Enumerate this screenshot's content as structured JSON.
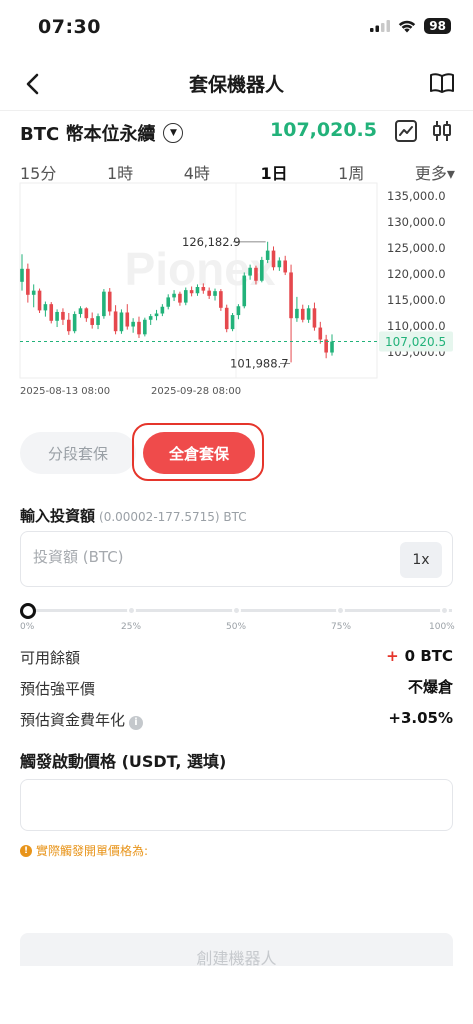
{
  "status_bar": {
    "time": "07:30",
    "battery": "98"
  },
  "nav": {
    "title": "套保機器人"
  },
  "pair": {
    "name": "BTC 幣本位永續",
    "price": "107,020.5"
  },
  "timeframes": [
    "15分",
    "1時",
    "4時",
    "1日",
    "1周",
    "更多▾"
  ],
  "active_timeframe": "1日",
  "chart_data": {
    "type": "candlestick",
    "y_ticks": [
      "135,000.0",
      "130,000.0",
      "125,000.0",
      "120,000.0",
      "115,000.0",
      "110,000.0",
      "105,000.0"
    ],
    "ylim": [
      105000,
      135000
    ],
    "x_ticks": [
      "2025-08-13 08:00",
      "2025-09-28 08:00"
    ],
    "annotations": {
      "high": "126,182.9",
      "low": "101,988.7"
    },
    "current_price": "107,020.5",
    "watermark": "Pionex",
    "candles": [
      [
        118500,
        123800,
        116800,
        121000
      ],
      [
        121000,
        122000,
        114500,
        116000
      ],
      [
        116000,
        118000,
        113600,
        116800
      ],
      [
        116800,
        117200,
        112500,
        113000
      ],
      [
        113000,
        114700,
        111800,
        114200
      ],
      [
        114200,
        114600,
        110500,
        111000
      ],
      [
        111000,
        113200,
        109800,
        112700
      ],
      [
        112700,
        113400,
        110200,
        111200
      ],
      [
        111200,
        112500,
        108300,
        109000
      ],
      [
        109000,
        112800,
        108600,
        112300
      ],
      [
        112300,
        113800,
        111600,
        113400
      ],
      [
        113400,
        113600,
        110800,
        111500
      ],
      [
        111500,
        112600,
        109500,
        110200
      ],
      [
        110200,
        112400,
        109400,
        111900
      ],
      [
        111900,
        117100,
        111400,
        116600
      ],
      [
        116600,
        117300,
        112000,
        112800
      ],
      [
        112800,
        114000,
        108400,
        109000
      ],
      [
        109000,
        113200,
        108500,
        112600
      ],
      [
        112600,
        114200,
        109300,
        109900
      ],
      [
        109900,
        111500,
        108700,
        110800
      ],
      [
        110800,
        111800,
        107700,
        108400
      ],
      [
        108400,
        111600,
        108000,
        111200
      ],
      [
        111200,
        112300,
        110200,
        111900
      ],
      [
        111900,
        113100,
        111100,
        112400
      ],
      [
        112400,
        114200,
        111900,
        113700
      ],
      [
        113700,
        116100,
        113200,
        115500
      ],
      [
        115500,
        116900,
        114800,
        116200
      ],
      [
        116200,
        116600,
        113900,
        114500
      ],
      [
        114500,
        117400,
        114000,
        116900
      ],
      [
        116900,
        117600,
        115700,
        116300
      ],
      [
        116300,
        118000,
        115800,
        117500
      ],
      [
        117500,
        118200,
        116200,
        116800
      ],
      [
        116800,
        117400,
        115200,
        115800
      ],
      [
        115800,
        117200,
        114900,
        116700
      ],
      [
        116700,
        117100,
        112900,
        113500
      ],
      [
        113500,
        114100,
        108800,
        109400
      ],
      [
        109400,
        112500,
        109000,
        112100
      ],
      [
        112100,
        114200,
        111300,
        113800
      ],
      [
        113800,
        120300,
        113400,
        119700
      ],
      [
        119700,
        121800,
        118900,
        121200
      ],
      [
        121200,
        121600,
        118000,
        118700
      ],
      [
        118700,
        123300,
        118400,
        122700
      ],
      [
        122700,
        126200,
        122100,
        124500
      ],
      [
        124500,
        125300,
        120700,
        121300
      ],
      [
        121300,
        123200,
        120600,
        122600
      ],
      [
        122600,
        123500,
        119800,
        120300
      ],
      [
        120300,
        121800,
        103000,
        111500
      ],
      [
        111500,
        115600,
        110800,
        113300
      ],
      [
        113300,
        114100,
        110700,
        111200
      ],
      [
        111200,
        114000,
        110600,
        113400
      ],
      [
        113400,
        114500,
        109100,
        109700
      ],
      [
        109700,
        110800,
        106600,
        107400
      ],
      [
        107400,
        108300,
        103800,
        104900
      ],
      [
        104900,
        108400,
        104300,
        107000
      ]
    ]
  },
  "mode_buttons": {
    "segmented": "分段套保",
    "full": "全倉套保"
  },
  "invest": {
    "label": "輸入投資額",
    "range": "(0.00002-177.5715) BTC",
    "placeholder": "投資額 (BTC)",
    "leverage": "1x",
    "progress_percent": 0,
    "ticks": [
      "0%",
      "25%",
      "50%",
      "75%",
      "100%"
    ]
  },
  "rows": [
    {
      "label": "可用餘額",
      "value": "0 BTC"
    },
    {
      "label": "預估強平價",
      "value": "不爆倉"
    },
    {
      "label": "預估資金費年化",
      "value": "+3.05%"
    }
  ],
  "trigger": {
    "label": "觸發啟動價格 (USDT, 選填)",
    "hint": "實際觸發開單價格為:"
  },
  "create_button": "創建機器人",
  "colors": {
    "up": "#22b27a",
    "down": "#e5484d",
    "accent": "#ef4b4b"
  }
}
